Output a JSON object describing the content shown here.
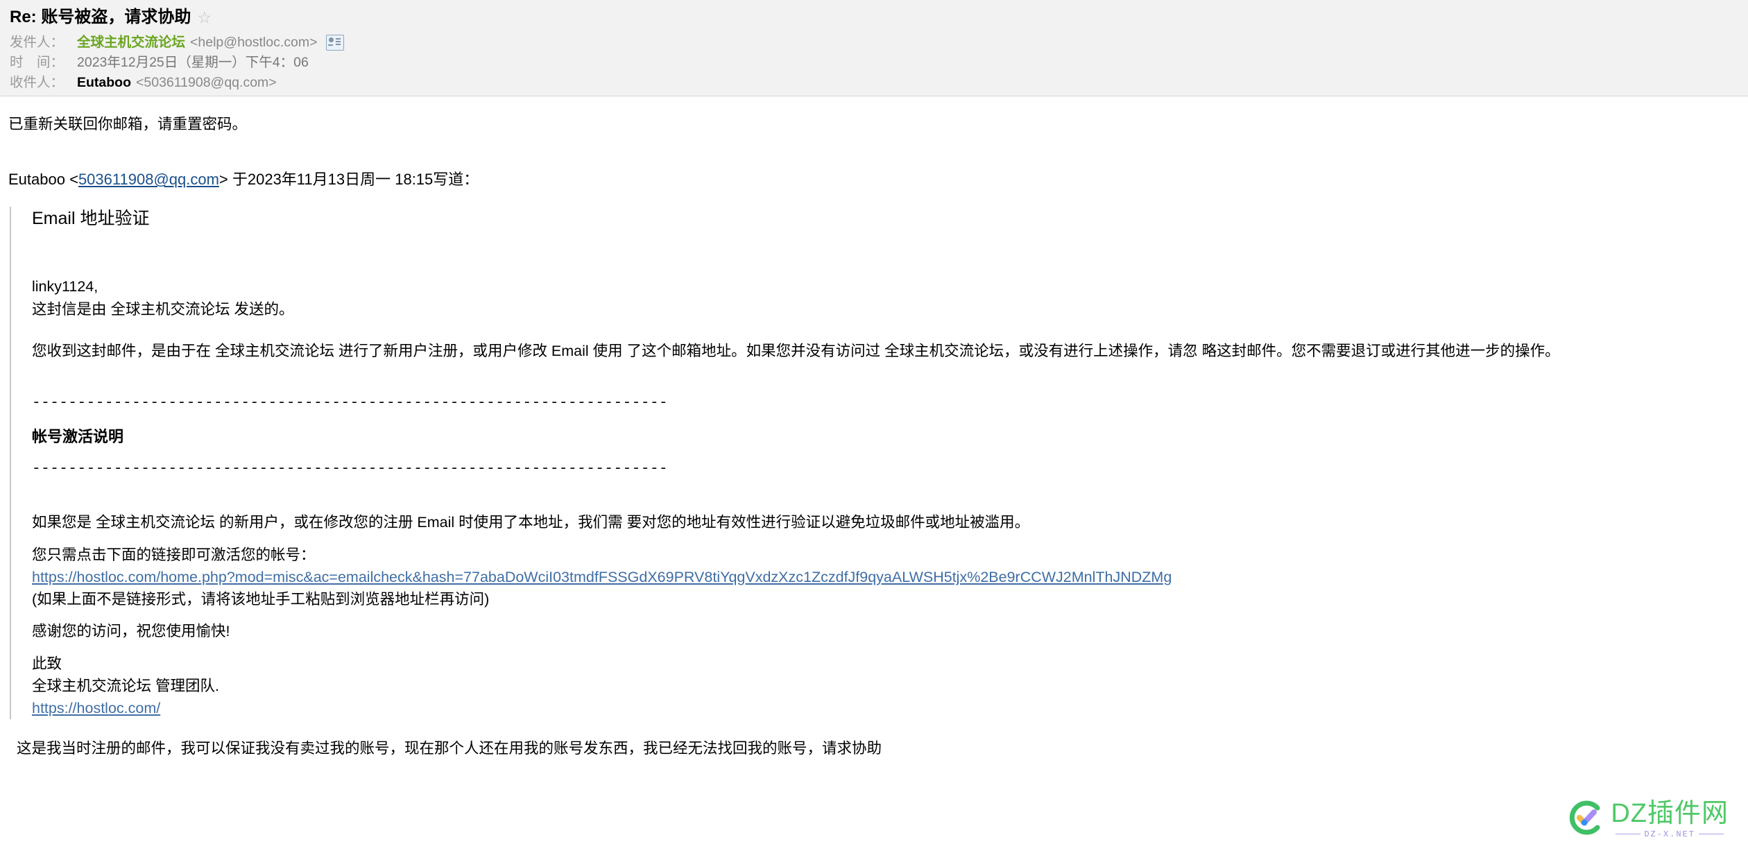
{
  "header": {
    "subject": "Re: 账号被盗，请求协助",
    "star_icon": "star-outline-icon",
    "from_label": "发件人：",
    "from_name": "全球主机交流论坛",
    "from_address": "<help@hostloc.com>",
    "contact_icon": "contact-card-icon",
    "time_label": "时　间：",
    "time_value": "2023年12月25日（星期一）下午4：06",
    "to_label": "收件人：",
    "to_name": "Eutaboo",
    "to_address": "<503611908@qq.com>"
  },
  "body": {
    "reply_text": "已重新关联回你邮箱，请重置密码。",
    "quote_attr_prefix": "Eutaboo <",
    "quote_attr_email": "503611908@qq.com",
    "quote_attr_suffix": "> 于2023年11月13日周一 18:15写道：",
    "quote": {
      "title": "Email 地址验证",
      "greeting": "linky1124,",
      "sent_by": "这封信是由 全球主机交流论坛 发送的。",
      "notice": "您收到这封邮件，是由于在 全球主机交流论坛 进行了新用户注册，或用户修改 Email 使用 了这个邮箱地址。如果您并没有访问过 全球主机交流论坛，或没有进行上述操作，请忽 略这封邮件。您不需要退订或进行其他进一步的操作。",
      "divider_top": "----------------------------------------------------------------------",
      "section_title": "帐号激活说明",
      "divider_bottom": "----------------------------------------------------------------------",
      "explain": "如果您是 全球主机交流论坛 的新用户，或在修改您的注册 Email 时使用了本地址，我们需 要对您的地址有效性进行验证以避免垃圾邮件或地址被滥用。",
      "click_prompt": "您只需点击下面的链接即可激活您的帐号：",
      "activation_link": "https://hostloc.com/home.php?mod=misc&ac=emailcheck&hash=77abaDoWciI03tmdfFSSGdX69PRV8tiYqgVxdzXzc1ZczdfJf9qyaALWSH5tjx%2Be9rCCWJ2MnlThJNDZMg",
      "fallback_note": "(如果上面不是链接形式，请将该地址手工粘贴到浏览器地址栏再访问)",
      "thanks": "感谢您的访问，祝您使用愉快!",
      "regards": "此致",
      "team": "全球主机交流论坛 管理团队.",
      "site_link": "https://hostloc.com/"
    },
    "tail_text": "这是我当时注册的邮件，我可以保证我没有卖过我的账号，现在那个人还在用我的账号发东西，我已经无法找回我的账号，请求协助"
  },
  "watermark": {
    "title": "DZ插件网",
    "subtitle": "DZ-X.NET",
    "logo_icon": "dz-check-circle-logo-icon",
    "brand_color": "#4cc764",
    "accent_color": "#a08ce0"
  }
}
